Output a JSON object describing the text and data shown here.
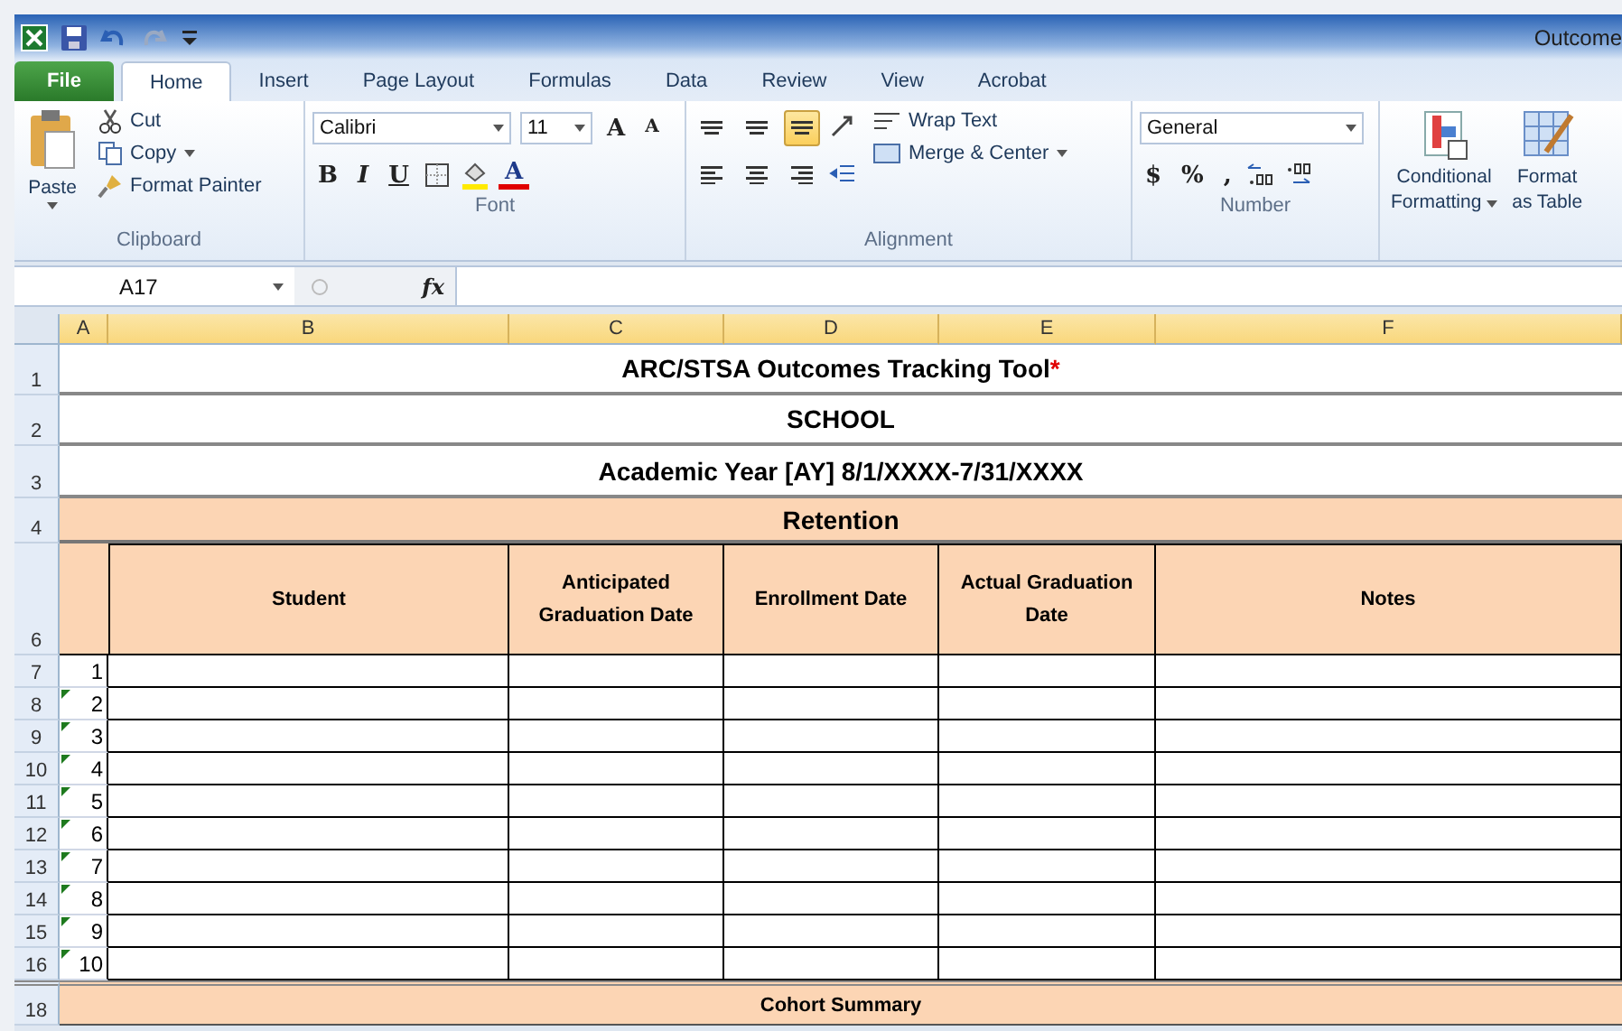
{
  "window": {
    "title": "Outcome"
  },
  "tabs": [
    {
      "label": "File",
      "kind": "file",
      "selected": false
    },
    {
      "label": "Home",
      "kind": "tab",
      "selected": true
    },
    {
      "label": "Insert",
      "kind": "tab",
      "selected": false
    },
    {
      "label": "Page Layout",
      "kind": "tab",
      "selected": false
    },
    {
      "label": "Formulas",
      "kind": "tab",
      "selected": false
    },
    {
      "label": "Data",
      "kind": "tab",
      "selected": false
    },
    {
      "label": "Review",
      "kind": "tab",
      "selected": false
    },
    {
      "label": "View",
      "kind": "tab",
      "selected": false
    },
    {
      "label": "Acrobat",
      "kind": "tab",
      "selected": false
    }
  ],
  "clipboard": {
    "paste": "Paste",
    "cut": "Cut",
    "copy": "Copy",
    "format_painter": "Format Painter",
    "label": "Clipboard"
  },
  "font": {
    "name": "Calibri",
    "size": "11",
    "grow": "A",
    "shrink": "A",
    "bold": "B",
    "italic": "I",
    "underline": "U",
    "font_color": "A",
    "label": "Font"
  },
  "alignment": {
    "buttons": [
      {
        "kind": "top",
        "selected": false
      },
      {
        "kind": "middle",
        "selected": false
      },
      {
        "kind": "bottom",
        "selected": true
      },
      {
        "kind": "left",
        "selected": false
      },
      {
        "kind": "center",
        "selected": false
      },
      {
        "kind": "right",
        "selected": false
      }
    ],
    "wrap_text": "Wrap Text",
    "merge_center": "Merge & Center",
    "label": "Alignment"
  },
  "number": {
    "format": "General",
    "currency": "$",
    "percent": "%",
    "comma": ",",
    "label": "Number"
  },
  "styles": {
    "conditional_formatting": [
      "Conditional",
      "Formatting"
    ],
    "format_as_table": [
      "Format",
      "as Table"
    ]
  },
  "formula_bar": {
    "name_box": "A17",
    "fx": "fx"
  },
  "columns": [
    "A",
    "B",
    "C",
    "D",
    "E",
    "F"
  ],
  "rows": [
    {
      "number": "1",
      "kind": "title",
      "text": "ARC/STSA Outcomes Tracking Tool",
      "mark": "*"
    },
    {
      "number": "2",
      "kind": "title",
      "text": "SCHOOL"
    },
    {
      "number": "3",
      "kind": "title",
      "text": "Academic Year [AY] 8/1/XXXX-7/31/XXXX"
    },
    {
      "number": "4",
      "kind": "section",
      "text": "Retention"
    },
    {
      "number": "6",
      "kind": "header",
      "cells": [
        "Student",
        "Anticipated Graduation Date",
        "Enrollment Date",
        "Actual Graduation Date",
        "Notes"
      ]
    },
    {
      "number": "7",
      "kind": "data",
      "index": "1",
      "flagged": false
    },
    {
      "number": "8",
      "kind": "data",
      "index": "2",
      "flagged": true
    },
    {
      "number": "9",
      "kind": "data",
      "index": "3",
      "flagged": true
    },
    {
      "number": "10",
      "kind": "data",
      "index": "4",
      "flagged": true
    },
    {
      "number": "11",
      "kind": "data",
      "index": "5",
      "flagged": true
    },
    {
      "number": "12",
      "kind": "data",
      "index": "6",
      "flagged": true
    },
    {
      "number": "13",
      "kind": "data",
      "index": "7",
      "flagged": true
    },
    {
      "number": "14",
      "kind": "data",
      "index": "8",
      "flagged": true
    },
    {
      "number": "15",
      "kind": "data",
      "index": "9",
      "flagged": true
    },
    {
      "number": "16",
      "kind": "data",
      "index": "10",
      "flagged": true
    },
    {
      "number": "18",
      "kind": "summary",
      "text": "Cohort Summary"
    }
  ]
}
